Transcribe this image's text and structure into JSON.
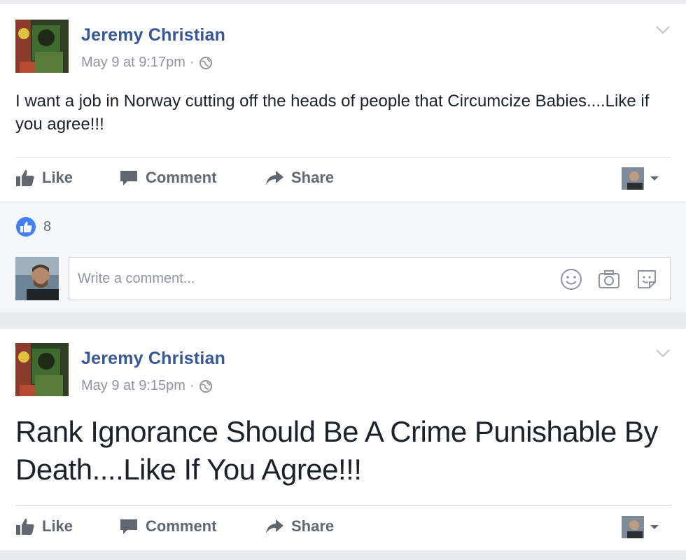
{
  "posts": [
    {
      "author": "Jeremy Christian",
      "timestamp": "May 9 at 9:17pm",
      "separator": "·",
      "privacy_icon": "globe-icon",
      "text": "I want a job in Norway cutting off the heads of people that Circumcize Babies....Like if you agree!!!",
      "actions": {
        "like": "Like",
        "comment": "Comment",
        "share": "Share"
      },
      "like_count": "8",
      "comment_placeholder": "Write a comment..."
    },
    {
      "author": "Jeremy Christian",
      "timestamp": "May 9 at 9:15pm",
      "separator": "·",
      "privacy_icon": "globe-icon",
      "text": "Rank Ignorance Should Be A Crime Punishable By Death....Like If You Agree!!!",
      "actions": {
        "like": "Like",
        "comment": "Comment",
        "share": "Share"
      }
    }
  ],
  "colors": {
    "link_blue": "#365899",
    "like_blue": "#4080ff",
    "meta_grey": "#90949c",
    "action_grey": "#606770",
    "feed_bg": "#e9ebee",
    "feedback_bg": "#f6f7f9"
  }
}
